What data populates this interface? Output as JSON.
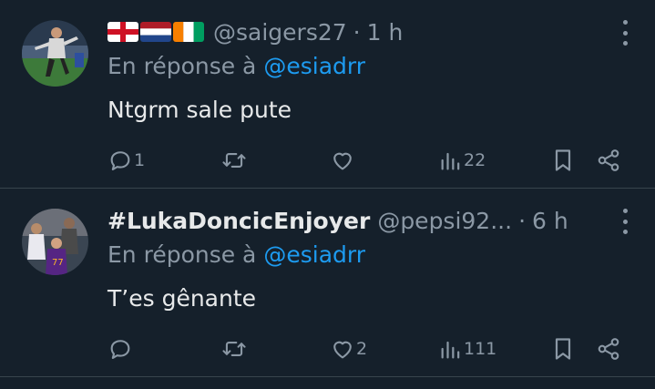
{
  "tweets": [
    {
      "display_name": "",
      "flags": [
        "england-flag",
        "netherlands-flag",
        "ivory-coast-flag"
      ],
      "handle": "@saigers27",
      "separator": "·",
      "time": "1 h",
      "reply_prefix": "En réponse à",
      "reply_to": "@esiadrr",
      "text": "Ntgrm sale pute",
      "actions": {
        "reply_count": "1",
        "retweet_count": "",
        "like_count": "",
        "views_count": "22"
      }
    },
    {
      "display_name": "#LukaDoncicEnjoyer",
      "flags": [],
      "handle": "@pepsi92...",
      "separator": "·",
      "time": "6 h",
      "reply_prefix": "En réponse à",
      "reply_to": "@esiadrr",
      "text": "T’es gênante",
      "actions": {
        "reply_count": "",
        "retweet_count": "",
        "like_count": "2",
        "views_count": "111"
      }
    }
  ],
  "colors": {
    "background": "#15202b",
    "text_primary": "#e7e9ea",
    "text_secondary": "#8b98a5",
    "accent": "#1d9bf0",
    "divider": "#38444d"
  },
  "icons": [
    "reply-icon",
    "retweet-icon",
    "like-icon",
    "views-icon",
    "bookmark-icon",
    "share-icon",
    "more-icon"
  ]
}
